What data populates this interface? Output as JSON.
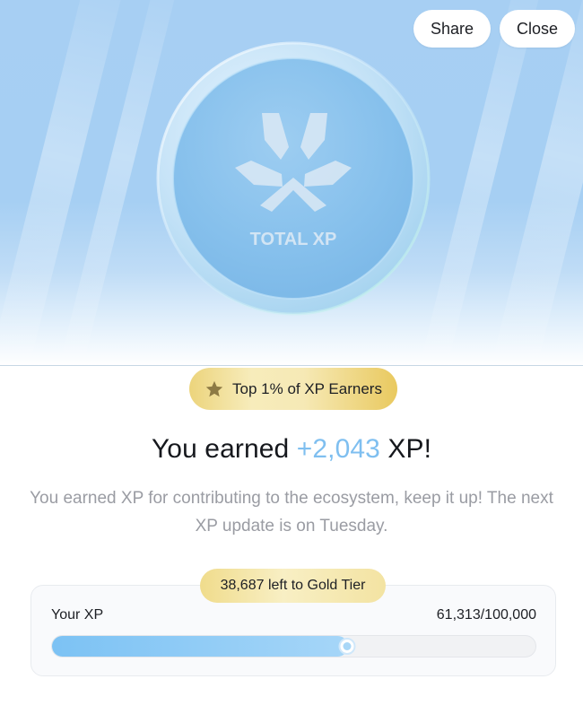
{
  "header": {
    "share_label": "Share",
    "close_label": "Close"
  },
  "coin": {
    "label": "TOTAL XP",
    "logo_icon": "tri-chevron-logo-icon"
  },
  "tier_badge": {
    "icon": "star-icon",
    "label": "Top 1% of XP Earners"
  },
  "headline": {
    "prefix": "You earned ",
    "amount": "+2,043",
    "suffix": " XP!"
  },
  "description": "You earned XP for contributing to the ecosystem, keep it up! The next XP update is on Tuesday.",
  "progress": {
    "remaining_label": "38,687 left to Gold Tier",
    "your_xp_label": "Your XP",
    "value_text": "61,313/100,000",
    "current": 61313,
    "max": 100000,
    "fraction": 0.6131
  },
  "colors": {
    "accent_blue": "#7fbff0",
    "gold": "#e9c95f",
    "hero_sky": "#a7cff3",
    "muted_text": "#9a9ca3"
  }
}
